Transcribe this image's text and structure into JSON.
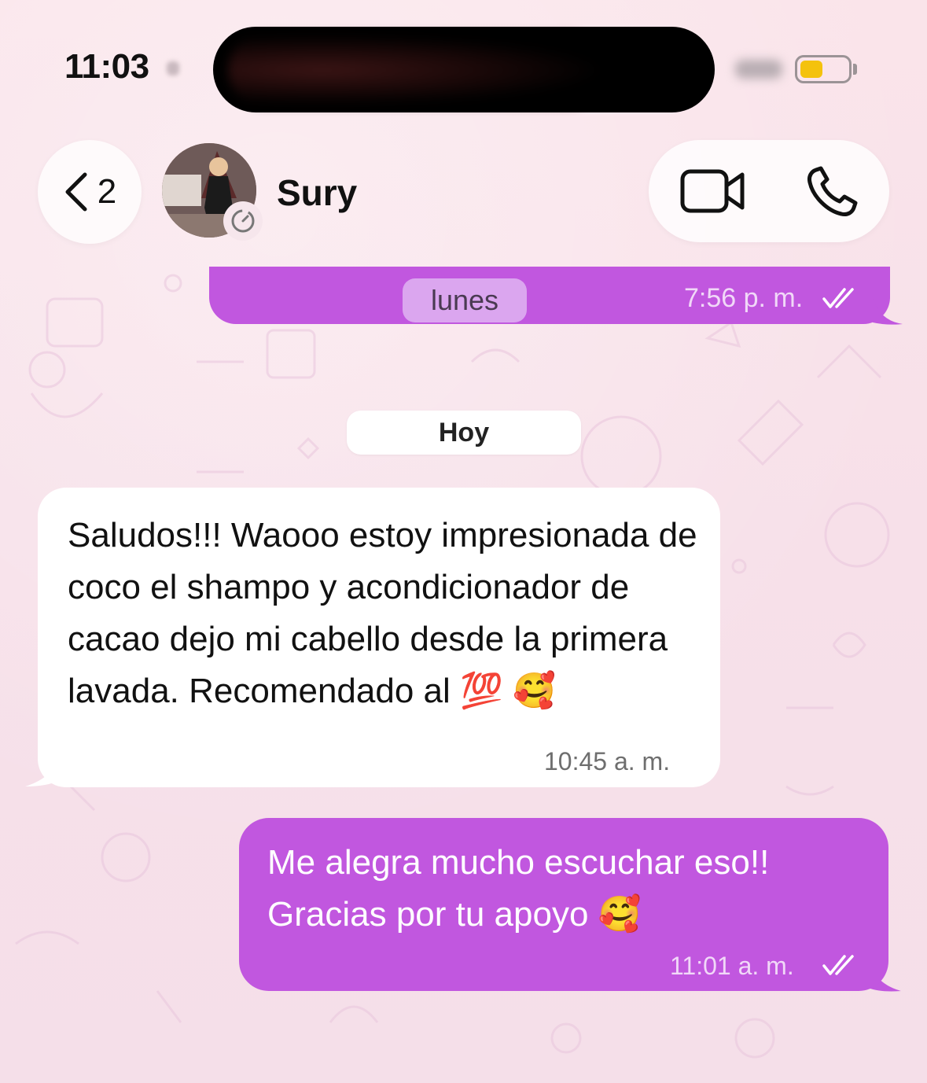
{
  "status_bar": {
    "time": "11:03",
    "battery_color": "#f4c20d"
  },
  "header": {
    "back_count": "2",
    "contact_name": "Sury",
    "icons": [
      "chevron-left-icon",
      "disappearing-timer-icon",
      "video-call-icon",
      "phone-icon"
    ]
  },
  "colors": {
    "outgoing_bubble": "#c157df",
    "incoming_bubble": "#ffffff",
    "wallpaper": "#f9e3ea"
  },
  "messages": [
    {
      "direction": "out",
      "label": "lunes",
      "time": "7:56 p. m.",
      "status": "read"
    },
    {
      "direction": "separator",
      "label": "Hoy"
    },
    {
      "direction": "in",
      "text": "Saludos!!! Waooo estoy impresionada de coco el shampo y acondicionador de cacao dejo mi cabello desde la primera lavada. Recomendado al 💯 🥰",
      "time": "10:45 a. m."
    },
    {
      "direction": "out",
      "text": "Me alegra mucho escuchar eso!! Gracias por tu apoyo 🥰",
      "time": "11:01 a. m.",
      "status": "read"
    }
  ]
}
